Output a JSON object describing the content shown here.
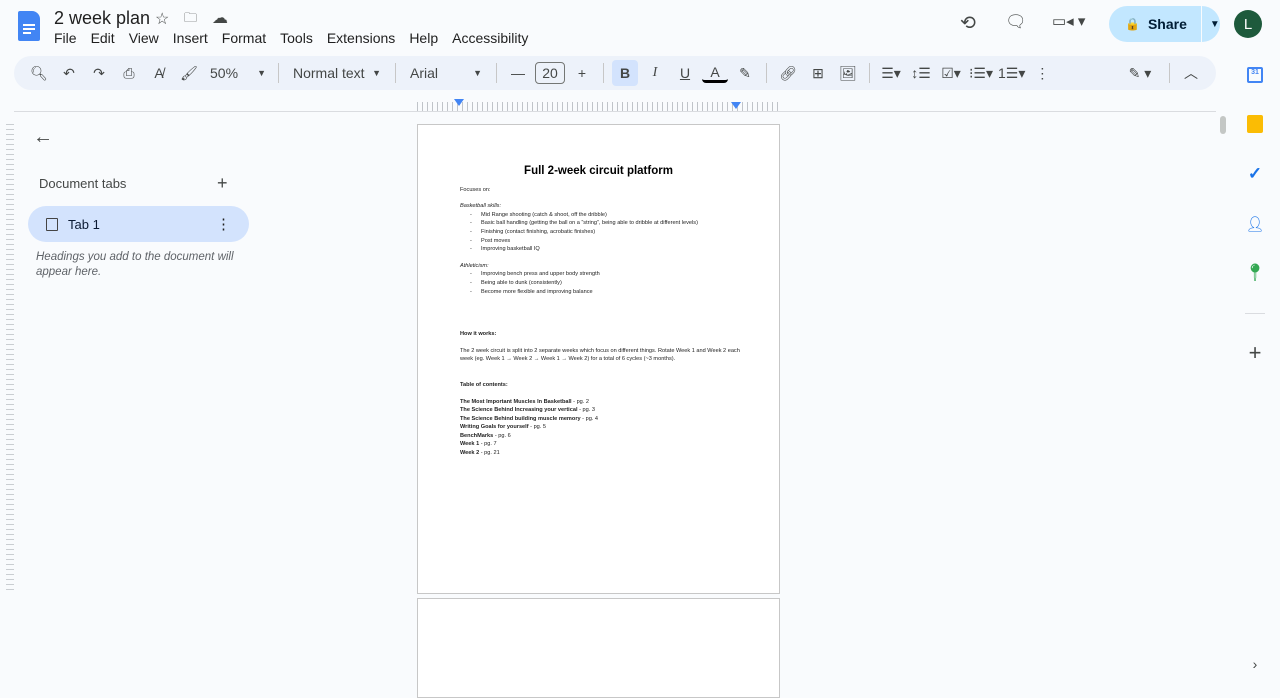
{
  "header": {
    "title": "2 week plan",
    "menus": [
      "File",
      "Edit",
      "View",
      "Insert",
      "Format",
      "Tools",
      "Extensions",
      "Help",
      "Accessibility"
    ],
    "share_label": "Share",
    "avatar_letter": "L"
  },
  "toolbar": {
    "zoom": "50%",
    "style": "Normal text",
    "font": "Arial",
    "font_size": "20"
  },
  "sidebar": {
    "heading": "Document tabs",
    "tab_label": "Tab 1",
    "hint": "Headings you add to the document will appear here."
  },
  "document": {
    "title": "Full 2-week circuit platform",
    "focuses": "Focuses on:",
    "skills_heading": "Basketball skills:",
    "skills": [
      "Mid Range shooting (catch & shoot, off the dribble)",
      "Basic ball handling (getting the ball on a “string”, being able to dribble at different levels)",
      "Finishing (contact finishing, acrobatic finishes)",
      "Post moves",
      "Improving basketball IQ"
    ],
    "athleticism_heading": "Athleticism:",
    "athleticism": [
      "Improving bench press and upper body strength",
      "Being able to dunk (consistently)",
      "Become more flexible and improving balance"
    ],
    "how_heading": "How it works:",
    "how_text": "The 2 week circuit is split into 2 separate weeks which focus on different things. Rotate Week 1 and Week 2 each week (eg. Week 1 → Week 2 → Week 1 → Week 2) for a total of 6 cycles (~3 months).",
    "toc_heading": "Table of contents:",
    "toc": [
      {
        "t": "The Most Important Muscles In Basketball",
        "p": " - pg. 2"
      },
      {
        "t": "The Science Behind Increasing your vertical",
        "p": " - pg. 3"
      },
      {
        "t": "The Science Behind building muscle memory",
        "p": " - pg. 4"
      },
      {
        "t": "Writing Goals for yourself",
        "p": " - pg. 5"
      },
      {
        "t": "BenchMarks",
        "p": " - pg. 6"
      },
      {
        "t": "Week 1",
        "p": " - pg. 7"
      },
      {
        "t": "Week 2",
        "p": " - pg. 21"
      }
    ]
  }
}
